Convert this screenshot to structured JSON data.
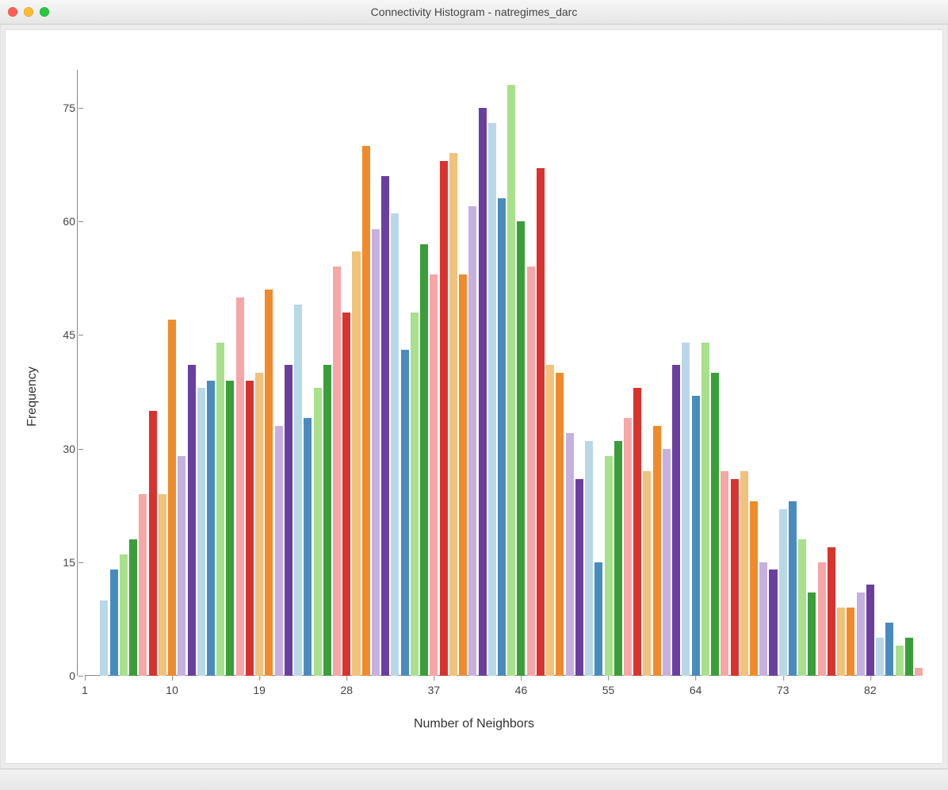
{
  "window_title": "Connectivity Histogram - natregimes_darc",
  "chart_data": {
    "type": "bar",
    "xlabel": "Number of Neighbors",
    "ylabel": "Frequency",
    "y_ticks": [
      0,
      15,
      30,
      45,
      60,
      75
    ],
    "ylim": [
      0,
      80
    ],
    "x_ticks": [
      1,
      10,
      19,
      28,
      37,
      46,
      55,
      64,
      73,
      82
    ],
    "xlim": [
      1,
      87
    ],
    "bars": [
      {
        "x": 3,
        "value": 10,
        "color": "#b8d8e8"
      },
      {
        "x": 4,
        "value": 14,
        "color": "#4a8bbf"
      },
      {
        "x": 5,
        "value": 16,
        "color": "#a8e08c"
      },
      {
        "x": 6,
        "value": 18,
        "color": "#3a9e3a"
      },
      {
        "x": 7,
        "value": 24,
        "color": "#f6a6a6"
      },
      {
        "x": 8,
        "value": 35,
        "color": "#d8332f"
      },
      {
        "x": 9,
        "value": 24,
        "color": "#f0c27a"
      },
      {
        "x": 10,
        "value": 47,
        "color": "#f08b2c"
      },
      {
        "x": 11,
        "value": 29,
        "color": "#c6b0e0"
      },
      {
        "x": 12,
        "value": 41,
        "color": "#6b3fa0"
      },
      {
        "x": 13,
        "value": 38,
        "color": "#b8d8e8"
      },
      {
        "x": 14,
        "value": 39,
        "color": "#4a8bbf"
      },
      {
        "x": 15,
        "value": 44,
        "color": "#a8e08c"
      },
      {
        "x": 16,
        "value": 39,
        "color": "#3a9e3a"
      },
      {
        "x": 17,
        "value": 50,
        "color": "#f6a6a6"
      },
      {
        "x": 18,
        "value": 39,
        "color": "#d8332f"
      },
      {
        "x": 19,
        "value": 40,
        "color": "#f0c27a"
      },
      {
        "x": 20,
        "value": 51,
        "color": "#f08b2c"
      },
      {
        "x": 21,
        "value": 33,
        "color": "#c6b0e0"
      },
      {
        "x": 22,
        "value": 41,
        "color": "#6b3fa0"
      },
      {
        "x": 23,
        "value": 49,
        "color": "#b8d8e8"
      },
      {
        "x": 24,
        "value": 34,
        "color": "#4a8bbf"
      },
      {
        "x": 25,
        "value": 38,
        "color": "#a8e08c"
      },
      {
        "x": 26,
        "value": 41,
        "color": "#3a9e3a"
      },
      {
        "x": 27,
        "value": 54,
        "color": "#f6a6a6"
      },
      {
        "x": 28,
        "value": 48,
        "color": "#d8332f"
      },
      {
        "x": 29,
        "value": 56,
        "color": "#f0c27a"
      },
      {
        "x": 30,
        "value": 70,
        "color": "#f08b2c"
      },
      {
        "x": 31,
        "value": 59,
        "color": "#c6b0e0"
      },
      {
        "x": 32,
        "value": 66,
        "color": "#6b3fa0"
      },
      {
        "x": 33,
        "value": 61,
        "color": "#b8d8e8"
      },
      {
        "x": 34,
        "value": 43,
        "color": "#4a8bbf"
      },
      {
        "x": 35,
        "value": 48,
        "color": "#a8e08c"
      },
      {
        "x": 36,
        "value": 57,
        "color": "#3a9e3a"
      },
      {
        "x": 37,
        "value": 53,
        "color": "#f6a6a6"
      },
      {
        "x": 38,
        "value": 68,
        "color": "#d8332f"
      },
      {
        "x": 39,
        "value": 69,
        "color": "#f0c27a"
      },
      {
        "x": 40,
        "value": 53,
        "color": "#f08b2c"
      },
      {
        "x": 41,
        "value": 62,
        "color": "#c6b0e0"
      },
      {
        "x": 42,
        "value": 75,
        "color": "#6b3fa0"
      },
      {
        "x": 43,
        "value": 73,
        "color": "#b8d8e8"
      },
      {
        "x": 44,
        "value": 63,
        "color": "#4a8bbf"
      },
      {
        "x": 45,
        "value": 78,
        "color": "#a8e08c"
      },
      {
        "x": 46,
        "value": 60,
        "color": "#3a9e3a"
      },
      {
        "x": 47,
        "value": 54,
        "color": "#f6a6a6"
      },
      {
        "x": 48,
        "value": 67,
        "color": "#d8332f"
      },
      {
        "x": 49,
        "value": 41,
        "color": "#f0c27a"
      },
      {
        "x": 50,
        "value": 40,
        "color": "#f08b2c"
      },
      {
        "x": 51,
        "value": 32,
        "color": "#c6b0e0"
      },
      {
        "x": 52,
        "value": 26,
        "color": "#6b3fa0"
      },
      {
        "x": 53,
        "value": 31,
        "color": "#b8d8e8"
      },
      {
        "x": 54,
        "value": 15,
        "color": "#4a8bbf"
      },
      {
        "x": 55,
        "value": 29,
        "color": "#a8e08c"
      },
      {
        "x": 56,
        "value": 31,
        "color": "#3a9e3a"
      },
      {
        "x": 57,
        "value": 34,
        "color": "#f6a6a6"
      },
      {
        "x": 58,
        "value": 38,
        "color": "#d8332f"
      },
      {
        "x": 59,
        "value": 27,
        "color": "#f0c27a"
      },
      {
        "x": 60,
        "value": 33,
        "color": "#f08b2c"
      },
      {
        "x": 61,
        "value": 30,
        "color": "#c6b0e0"
      },
      {
        "x": 62,
        "value": 41,
        "color": "#6b3fa0"
      },
      {
        "x": 63,
        "value": 44,
        "color": "#b8d8e8"
      },
      {
        "x": 64,
        "value": 37,
        "color": "#4a8bbf"
      },
      {
        "x": 65,
        "value": 44,
        "color": "#a8e08c"
      },
      {
        "x": 66,
        "value": 40,
        "color": "#3a9e3a"
      },
      {
        "x": 67,
        "value": 27,
        "color": "#f6a6a6"
      },
      {
        "x": 68,
        "value": 26,
        "color": "#d8332f"
      },
      {
        "x": 69,
        "value": 27,
        "color": "#f0c27a"
      },
      {
        "x": 70,
        "value": 23,
        "color": "#f08b2c"
      },
      {
        "x": 71,
        "value": 15,
        "color": "#c6b0e0"
      },
      {
        "x": 72,
        "value": 14,
        "color": "#6b3fa0"
      },
      {
        "x": 73,
        "value": 22,
        "color": "#b8d8e8"
      },
      {
        "x": 74,
        "value": 23,
        "color": "#4a8bbf"
      },
      {
        "x": 75,
        "value": 18,
        "color": "#a8e08c"
      },
      {
        "x": 76,
        "value": 11,
        "color": "#3a9e3a"
      },
      {
        "x": 77,
        "value": 15,
        "color": "#f6a6a6"
      },
      {
        "x": 78,
        "value": 17,
        "color": "#d8332f"
      },
      {
        "x": 79,
        "value": 9,
        "color": "#f0c27a"
      },
      {
        "x": 80,
        "value": 9,
        "color": "#f08b2c"
      },
      {
        "x": 81,
        "value": 11,
        "color": "#c6b0e0"
      },
      {
        "x": 82,
        "value": 12,
        "color": "#6b3fa0"
      },
      {
        "x": 83,
        "value": 5,
        "color": "#b8d8e8"
      },
      {
        "x": 84,
        "value": 7,
        "color": "#4a8bbf"
      },
      {
        "x": 85,
        "value": 4,
        "color": "#a8e08c"
      },
      {
        "x": 86,
        "value": 5,
        "color": "#3a9e3a"
      },
      {
        "x": 87,
        "value": 1,
        "color": "#f6a6a6"
      }
    ]
  }
}
